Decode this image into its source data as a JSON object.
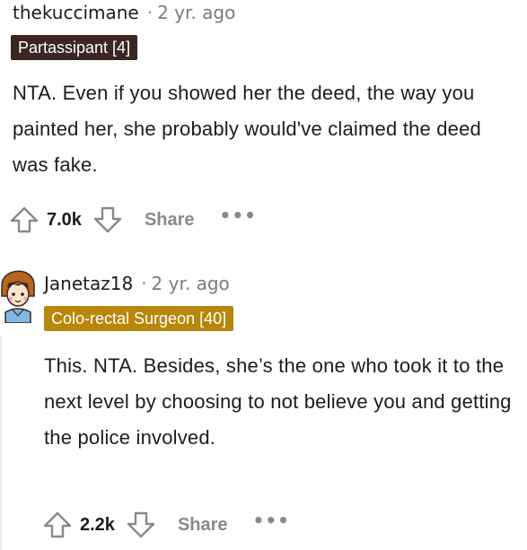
{
  "comments": [
    {
      "username": "thekuccimane",
      "separator": "·",
      "time": "2 yr. ago",
      "flair": "Partassipant [4]",
      "flair_color": "#3a2722",
      "body": "NTA. Even if you showed her the deed, the way you painted her, she probably would've claimed the deed was fake.",
      "votes": "7.0k",
      "share_label": "Share",
      "more_label": "•••"
    },
    {
      "username": "Janetaz18",
      "separator": "·",
      "time": "2 yr. ago",
      "flair": "Colo-rectal Surgeon [40]",
      "flair_color": "#b8860b",
      "body": "This. NTA. Besides, she’s the one who took it to the next level by choosing to not believe you and getting the police involved.",
      "votes": "2.2k",
      "share_label": "Share",
      "more_label": "•••"
    }
  ],
  "icons": {
    "upvote": "arrow-up-icon",
    "downvote": "arrow-down-icon",
    "more": "ellipsis-icon",
    "avatar": "avatar-icon"
  }
}
